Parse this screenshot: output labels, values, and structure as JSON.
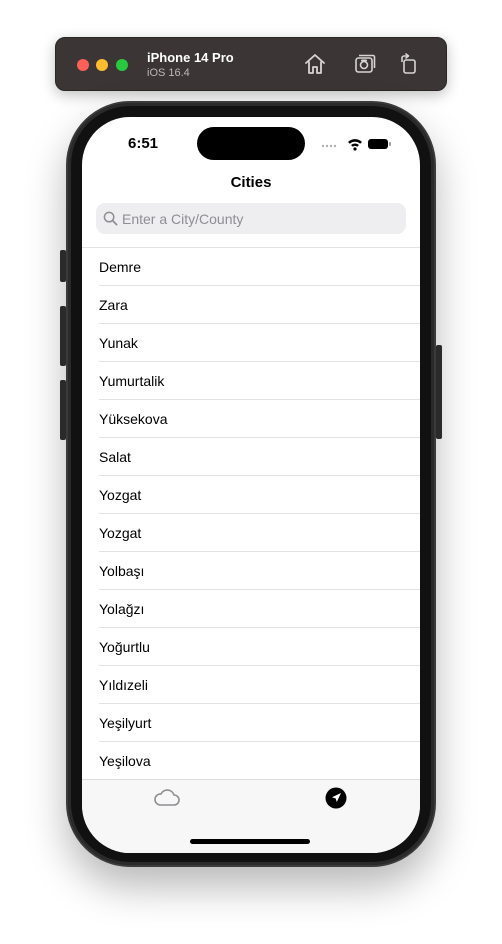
{
  "simulator": {
    "device_name": "iPhone 14 Pro",
    "os_version": "iOS 16.4",
    "icons": [
      "home-icon",
      "screenshot-icon",
      "rotate-icon"
    ]
  },
  "status_bar": {
    "time": "6:51",
    "icons": [
      "signal-dots-icon",
      "wifi-icon",
      "battery-icon"
    ]
  },
  "nav": {
    "title": "Cities"
  },
  "search": {
    "placeholder": "Enter a City/County",
    "value": ""
  },
  "cities": [
    "Demre",
    "Zara",
    "Yunak",
    "Yumurtalik",
    "Yüksekova",
    "Salat",
    "Yozgat",
    "Yozgat",
    "Yolbaşı",
    "Yolağzı",
    "Yoğurtlu",
    "Yıldızeli",
    "Yeşilyurt",
    "Yeşilova"
  ],
  "tabbar": {
    "tabs": [
      {
        "icon": "cloud-icon",
        "selected": false
      },
      {
        "icon": "location-arrow-icon",
        "selected": true
      }
    ]
  },
  "colors": {
    "toolbar_bg": "#3b3635",
    "search_bg": "#eeeef0",
    "placeholder": "#8e8e93",
    "separator": "#e3e3e6",
    "tab_inactive": "#8e8e93",
    "tab_active": "#000000"
  }
}
